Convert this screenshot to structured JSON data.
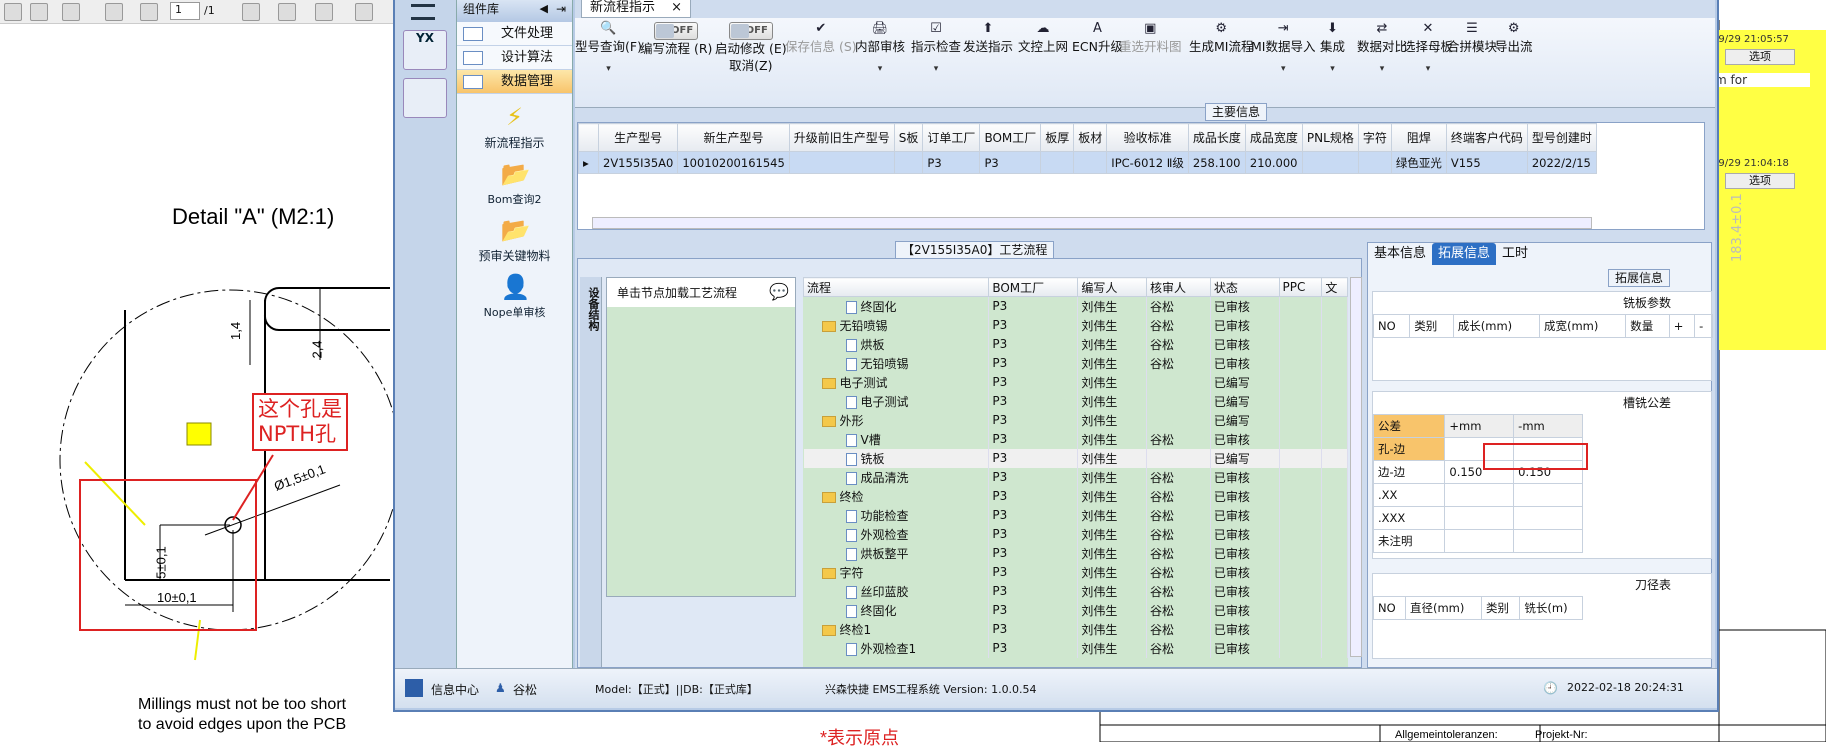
{
  "pdf_toolbar": {
    "page": "1",
    "page_total": "/1"
  },
  "drawing": {
    "detail": "Detail \"A\" (M2:1)",
    "dim_14": "1,4",
    "dim_24": "2,4",
    "dim_hole": "Ø1,5±0,1",
    "dim_5": "5±0,1",
    "dim_10": "10±0,1",
    "note": "这个孔是\nNPTH孔",
    "milling": "Millings must not be too short\nto avoid edges upon the PCB",
    "bottom": "*表示原点",
    "stamp1": "Allgemeintoleranzen:",
    "stamp2": "Projekt-Nr:"
  },
  "side_notes": [
    {
      "date": "/9/29 21:05:57",
      "opt": "选项",
      "text": "m for"
    },
    {
      "date": "/9/29 21:04:18",
      "opt": "选项",
      "text": "183.4±0.1"
    }
  ],
  "leftstrip": {
    "logo": "YX"
  },
  "component": {
    "title": "组件库",
    "items": [
      "文件处理",
      "设计算法",
      "数据管理"
    ],
    "tools": [
      "新流程指示",
      "Bom查询2",
      "预审关键物料",
      "Nope单审核"
    ]
  },
  "tab": {
    "label": "新流程指示"
  },
  "ribbon": [
    {
      "label": "型号查询(F)",
      "icon": "🔍",
      "dd": true
    },
    {
      "label": "编写流程 (R)",
      "toggle": "OFF"
    },
    {
      "label": "启动修改 (E)\n取消(Z)",
      "toggle": "OFF"
    },
    {
      "label": "保存信息 (S)",
      "icon": "✔",
      "disabled": true
    },
    {
      "label": "内部审核",
      "icon": "🖨",
      "dd": true
    },
    {
      "label": "指示检查",
      "icon": "☑",
      "dd": true
    },
    {
      "label": "发送指示",
      "icon": "⬆"
    },
    {
      "label": "文控上网",
      "icon": "☁"
    },
    {
      "label": "ECN升级",
      "icon": "A"
    },
    {
      "label": "重选开料图",
      "icon": "▣",
      "disabled": true
    },
    {
      "label": "生成MI流程",
      "icon": "⚙"
    },
    {
      "label": "MI数据导入",
      "icon": "⇥",
      "dd": true
    },
    {
      "label": "集成",
      "icon": "⬇",
      "dd": true
    },
    {
      "label": "数据对比",
      "icon": "⇄",
      "dd": true
    },
    {
      "label": "选择母板",
      "icon": "✕",
      "dd": true
    },
    {
      "label": "合拼模块",
      "icon": "☰"
    },
    {
      "label": "导出流",
      "icon": "⚙"
    }
  ],
  "main_info": {
    "title": "主要信息",
    "columns": [
      "生产型号",
      "新生产型号",
      "升级前旧生产型号",
      "S板",
      "订单工厂",
      "BOM工厂",
      "板厚",
      "板材",
      "验收标准",
      "成品长度",
      "成品宽度",
      "PNL规格",
      "字符",
      "阻焊",
      "终端客户代码",
      "型号创建时"
    ],
    "row": [
      "2V155I35A0",
      "10010200161545",
      "",
      "",
      "P3",
      "P3",
      "",
      "",
      "IPC-6012 Ⅱ级",
      "258.100",
      "210.000",
      "",
      "",
      "绿色亚光",
      "V155",
      "2022/2/15"
    ]
  },
  "flow": {
    "title": "【2V155I35A0】工艺流程",
    "side_tab": "设备结构",
    "hint": "单击节点加载工艺流程",
    "columns": [
      "流程",
      "BOM工厂",
      "编写人",
      "核审人",
      "状态",
      "PPC",
      "文"
    ],
    "rows": [
      {
        "name": "终固化",
        "lvl": 2,
        "f": "P3",
        "w": "刘伟生",
        "r": "谷松",
        "s": "已审核"
      },
      {
        "name": "无铅喷锡",
        "lvl": 1,
        "f": "P3",
        "w": "刘伟生",
        "r": "谷松",
        "s": "已审核"
      },
      {
        "name": "烘板",
        "lvl": 2,
        "f": "P3",
        "w": "刘伟生",
        "r": "谷松",
        "s": "已审核"
      },
      {
        "name": "无铅喷锡",
        "lvl": 2,
        "f": "P3",
        "w": "刘伟生",
        "r": "谷松",
        "s": "已审核"
      },
      {
        "name": "电子测试",
        "lvl": 1,
        "f": "P3",
        "w": "刘伟生",
        "r": "",
        "s": "已编写"
      },
      {
        "name": "电子测试",
        "lvl": 2,
        "f": "P3",
        "w": "刘伟生",
        "r": "",
        "s": "已编写"
      },
      {
        "name": "外形",
        "lvl": 1,
        "f": "P3",
        "w": "刘伟生",
        "r": "",
        "s": "已编写"
      },
      {
        "name": "V槽",
        "lvl": 2,
        "f": "P3",
        "w": "刘伟生",
        "r": "谷松",
        "s": "已审核"
      },
      {
        "name": "铣板",
        "lvl": 2,
        "f": "P3",
        "w": "刘伟生",
        "r": "",
        "s": "已编写",
        "hl": true
      },
      {
        "name": "成品清洗",
        "lvl": 2,
        "f": "P3",
        "w": "刘伟生",
        "r": "谷松",
        "s": "已审核"
      },
      {
        "name": "终检",
        "lvl": 1,
        "f": "P3",
        "w": "刘伟生",
        "r": "谷松",
        "s": "已审核"
      },
      {
        "name": "功能检查",
        "lvl": 2,
        "f": "P3",
        "w": "刘伟生",
        "r": "谷松",
        "s": "已审核"
      },
      {
        "name": "外观检查",
        "lvl": 2,
        "f": "P3",
        "w": "刘伟生",
        "r": "谷松",
        "s": "已审核"
      },
      {
        "name": "烘板整平",
        "lvl": 2,
        "f": "P3",
        "w": "刘伟生",
        "r": "谷松",
        "s": "已审核"
      },
      {
        "name": "字符",
        "lvl": 1,
        "f": "P3",
        "w": "刘伟生",
        "r": "谷松",
        "s": "已审核"
      },
      {
        "name": "丝印蓝胶",
        "lvl": 2,
        "f": "P3",
        "w": "刘伟生",
        "r": "谷松",
        "s": "已审核"
      },
      {
        "name": "终固化",
        "lvl": 2,
        "f": "P3",
        "w": "刘伟生",
        "r": "谷松",
        "s": "已审核"
      },
      {
        "name": "终检1",
        "lvl": 1,
        "f": "P3",
        "w": "刘伟生",
        "r": "谷松",
        "s": "已审核"
      },
      {
        "name": "外观检查1",
        "lvl": 2,
        "f": "P3",
        "w": "刘伟生",
        "r": "谷松",
        "s": "已审核"
      }
    ]
  },
  "right": {
    "tabs": [
      "基本信息",
      "拓展信息",
      "工时"
    ],
    "ext_title": "拓展信息",
    "mill_title": "铣板参数",
    "mill_cols": [
      "NO",
      "类别",
      "成长(mm)",
      "成宽(mm)",
      "数量",
      "+",
      "-"
    ],
    "tol_title": "槽铣公差",
    "tol_cols": [
      "公差",
      "+mm",
      "-mm"
    ],
    "tol_rows": [
      [
        "孔-边",
        "",
        ""
      ],
      [
        "边-边",
        "0.150",
        "0.150"
      ],
      [
        ".XX",
        "",
        ""
      ],
      [
        ".XXX",
        "",
        ""
      ],
      [
        "未注明",
        "",
        ""
      ]
    ],
    "tool_title": "刀径表",
    "tool_cols": [
      "NO",
      "直径(mm)",
      "类别",
      "铣长(m)"
    ]
  },
  "status": {
    "center": "信息中心",
    "user": "谷松",
    "model": "Model:【正式】||DB:【正式库】",
    "sys": "兴森快捷 EMS工程系统 Version: 1.0.0.54",
    "time": "2022-02-18 20:24:31"
  }
}
